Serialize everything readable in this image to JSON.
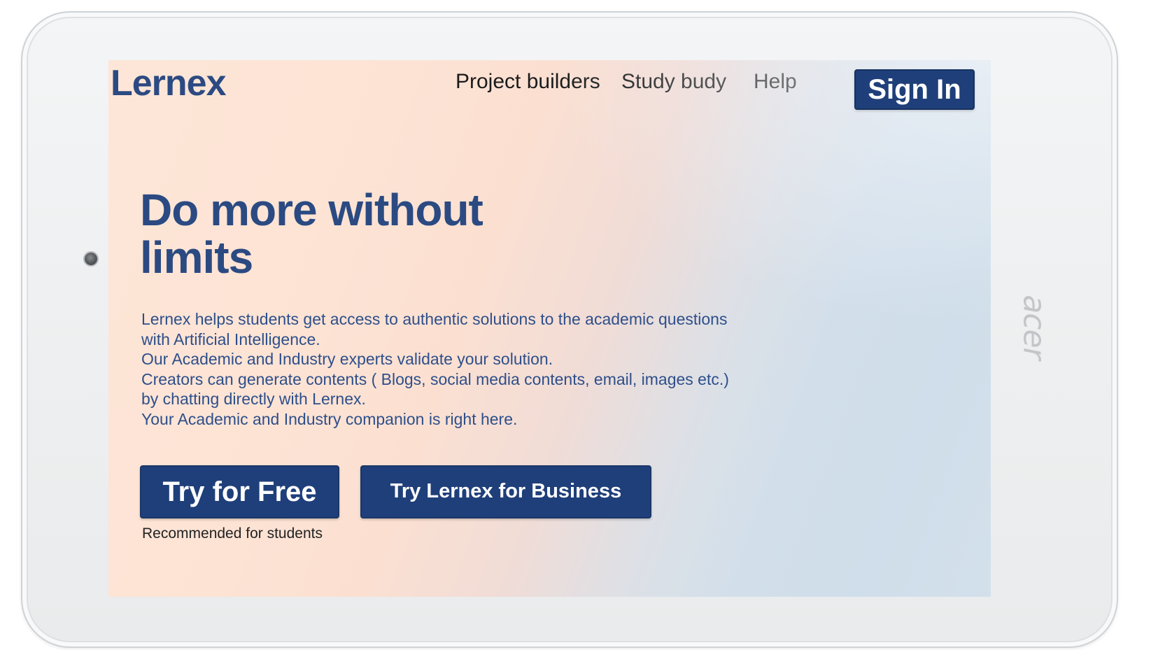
{
  "device": {
    "brand_mark": "acer"
  },
  "header": {
    "logo": "Lernex",
    "nav": [
      {
        "label": "Project builders"
      },
      {
        "label": "Study budy"
      },
      {
        "label": "Help"
      }
    ],
    "signin_label": "Sign In"
  },
  "hero": {
    "title": "Do more without limits",
    "body_lines": [
      "Lernex helps students get access to authentic solutions to the academic questions",
      "with Artificial Intelligence.",
      "Our Academic and Industry experts validate your solution.",
      "Creators can generate contents ( Blogs, social media contents, email, images etc.)",
      "by chatting directly with Lernex.",
      "Your Academic and Industry companion is right here."
    ],
    "primary_cta": "Try for Free",
    "secondary_cta": "Try Lernex for Business",
    "primary_note": "Recommended for students"
  },
  "colors": {
    "brand_navy": "#1f3f7a",
    "heading_blue": "#2b4a82",
    "body_blue": "#2e4f8a",
    "bg_peach": "#fde3d4",
    "bg_blue": "#cfdeea"
  }
}
